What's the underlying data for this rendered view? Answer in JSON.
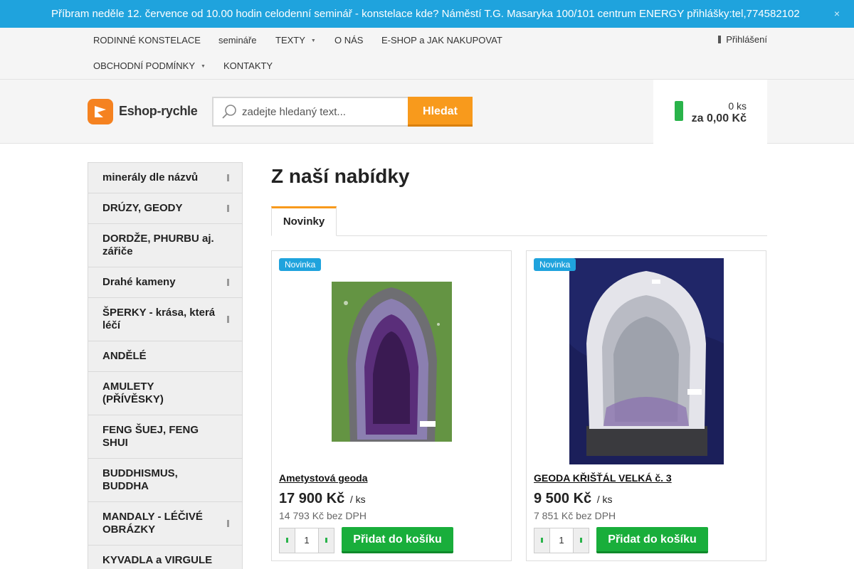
{
  "announcement": {
    "text": "Příbram neděle 12. července od 10.00 hodin celodenní seminář -  konstelace kde? Náměstí T.G. Masaryka 100/101 centrum ENERGY přihlášky:tel,774582102",
    "close_symbol": "×"
  },
  "nav": {
    "items": [
      {
        "label": "RODINNÉ KONSTELACE"
      },
      {
        "label": "semináře"
      },
      {
        "label": "TEXTY"
      },
      {
        "label": "O NÁS"
      },
      {
        "label": "E-SHOP a JAK NAKUPOVAT"
      },
      {
        "label": "OBCHODNÍ PODMÍNKY"
      },
      {
        "label": "KONTAKTY"
      }
    ],
    "login_label": "Přihlášení"
  },
  "header": {
    "logo_text": "Eshop-rychle",
    "search_placeholder": "zadejte hledaný text...",
    "search_button": "Hledat",
    "cart_count": "0 ks",
    "cart_total": "za 0,00 Kč"
  },
  "sidebar": {
    "categories": [
      {
        "label": "minerály dle názvů"
      },
      {
        "label": "DRÚZY, GEODY"
      },
      {
        "label": "DORDŽE, PHURBU aj. zářiče"
      },
      {
        "label": "Drahé kameny"
      },
      {
        "label": "ŠPERKY - krása, která léčí"
      },
      {
        "label": "ANDĚLÉ"
      },
      {
        "label": "AMULETY (PŘÍVĚSKY)"
      },
      {
        "label": "FENG ŠUEJ, FENG SHUI"
      },
      {
        "label": "BUDDHISMUS, BUDDHA"
      },
      {
        "label": "MANDALY - LÉČIVÉ OBRÁZKY"
      },
      {
        "label": "KYVADLA a VIRGULE"
      }
    ]
  },
  "main": {
    "title": "Z naší nabídky",
    "tab_label": "Novinky",
    "products": [
      {
        "badge": "Novinka",
        "title": "Ametystová geoda",
        "price": "17 900 Kč",
        "unit": "/ ks",
        "price_net": "14 793 Kč bez DPH",
        "qty": "1",
        "add_label": "Přidat do košíku"
      },
      {
        "badge": "Novinka",
        "title": "GEODA KŘIŠŤÁL VELKÁ č. 3",
        "price": "9 500 Kč",
        "unit": "/ ks",
        "price_net": "7 851 Kč bez DPH",
        "qty": "1",
        "add_label": "Přidat do košíku"
      }
    ]
  },
  "colors": {
    "announce_bg": "#1fa3dd",
    "accent_orange": "#f89a1c",
    "add_green": "#19ae3b"
  }
}
